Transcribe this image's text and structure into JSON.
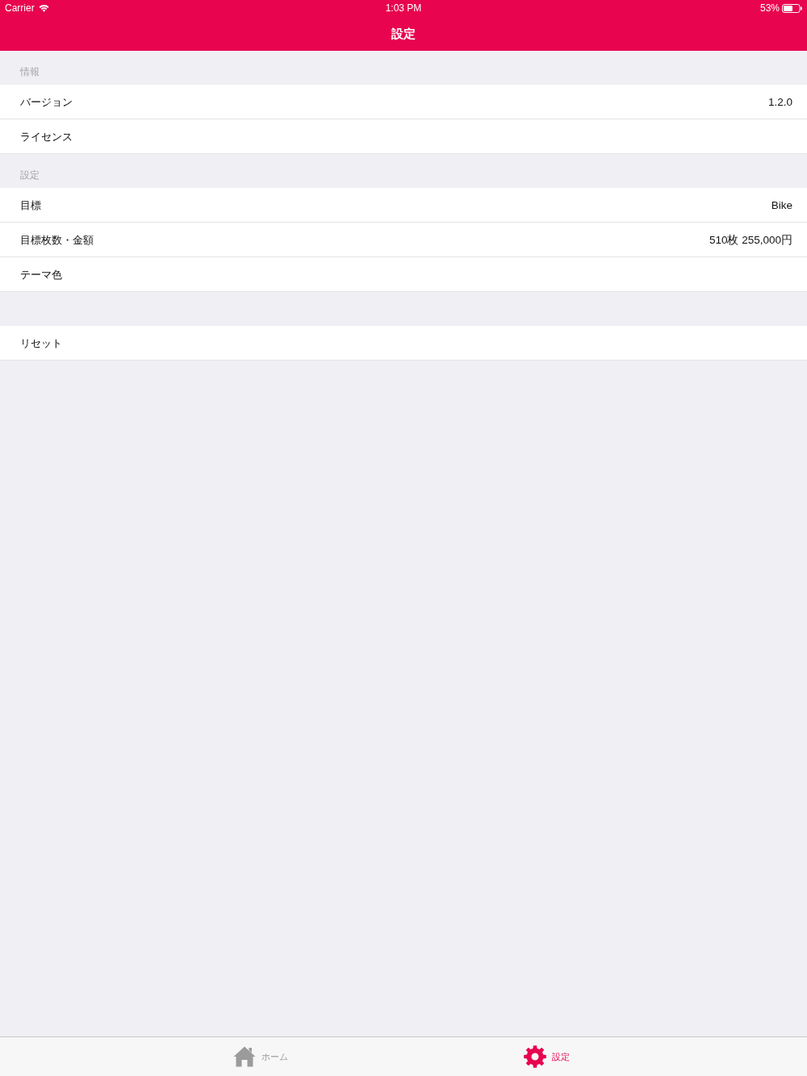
{
  "status_bar": {
    "carrier": "Carrier",
    "time": "1:03 PM",
    "battery": "53%"
  },
  "nav_bar": {
    "title": "設定"
  },
  "sections": [
    {
      "header": "情報",
      "rows": [
        {
          "label": "バージョン",
          "value": "1.2.0"
        },
        {
          "label": "ライセンス"
        }
      ]
    },
    {
      "header": "設定",
      "rows": [
        {
          "label": "目標",
          "value": "Bike"
        },
        {
          "label": "目標枚数・金額",
          "value": "510枚 255,000円"
        },
        {
          "label": "テーマ色"
        }
      ]
    },
    {
      "rows": [
        {
          "label": "リセット"
        }
      ]
    }
  ],
  "tab_bar": {
    "tabs": [
      {
        "label": "ホーム",
        "selected": false
      },
      {
        "label": "設定",
        "selected": true
      }
    ]
  }
}
